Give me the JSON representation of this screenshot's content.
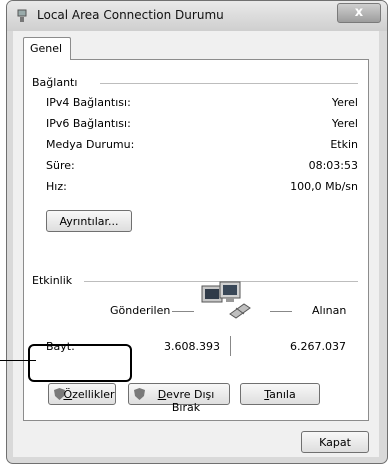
{
  "window": {
    "title": "Local Area Connection Durumu",
    "close_label": "x"
  },
  "tabs": [
    {
      "label": "Genel"
    }
  ],
  "connection": {
    "group_label": "Bağlantı",
    "rows": [
      {
        "label": "IPv4 Bağlantısı:",
        "value": "Yerel"
      },
      {
        "label": "IPv6 Bağlantısı:",
        "value": "Yerel"
      },
      {
        "label": "Medya Durumu:",
        "value": "Etkin"
      },
      {
        "label": "Süre:",
        "value": "08:03:53"
      },
      {
        "label": "Hız:",
        "value": "100,0 Mb/sn"
      }
    ],
    "details_button": "Ayrıntılar..."
  },
  "activity": {
    "group_label": "Etkinlik",
    "sent_label": "Gönderilen",
    "received_label": "Alınan",
    "bytes_label": "Bayt:",
    "sent_value": "3.608.393",
    "received_value": "6.267.037"
  },
  "buttons": {
    "properties": {
      "prefix": "Ö",
      "rest": "zellikler"
    },
    "disable": {
      "prefix": "D",
      "rest": "evre Dışı Bırak"
    },
    "diagnose": {
      "prefix": "T",
      "rest": "anıla"
    },
    "close": "Kapat"
  },
  "icons": {
    "app": "network-icon",
    "shield": "uac-shield-icon",
    "connection": "network-computers-icon"
  }
}
